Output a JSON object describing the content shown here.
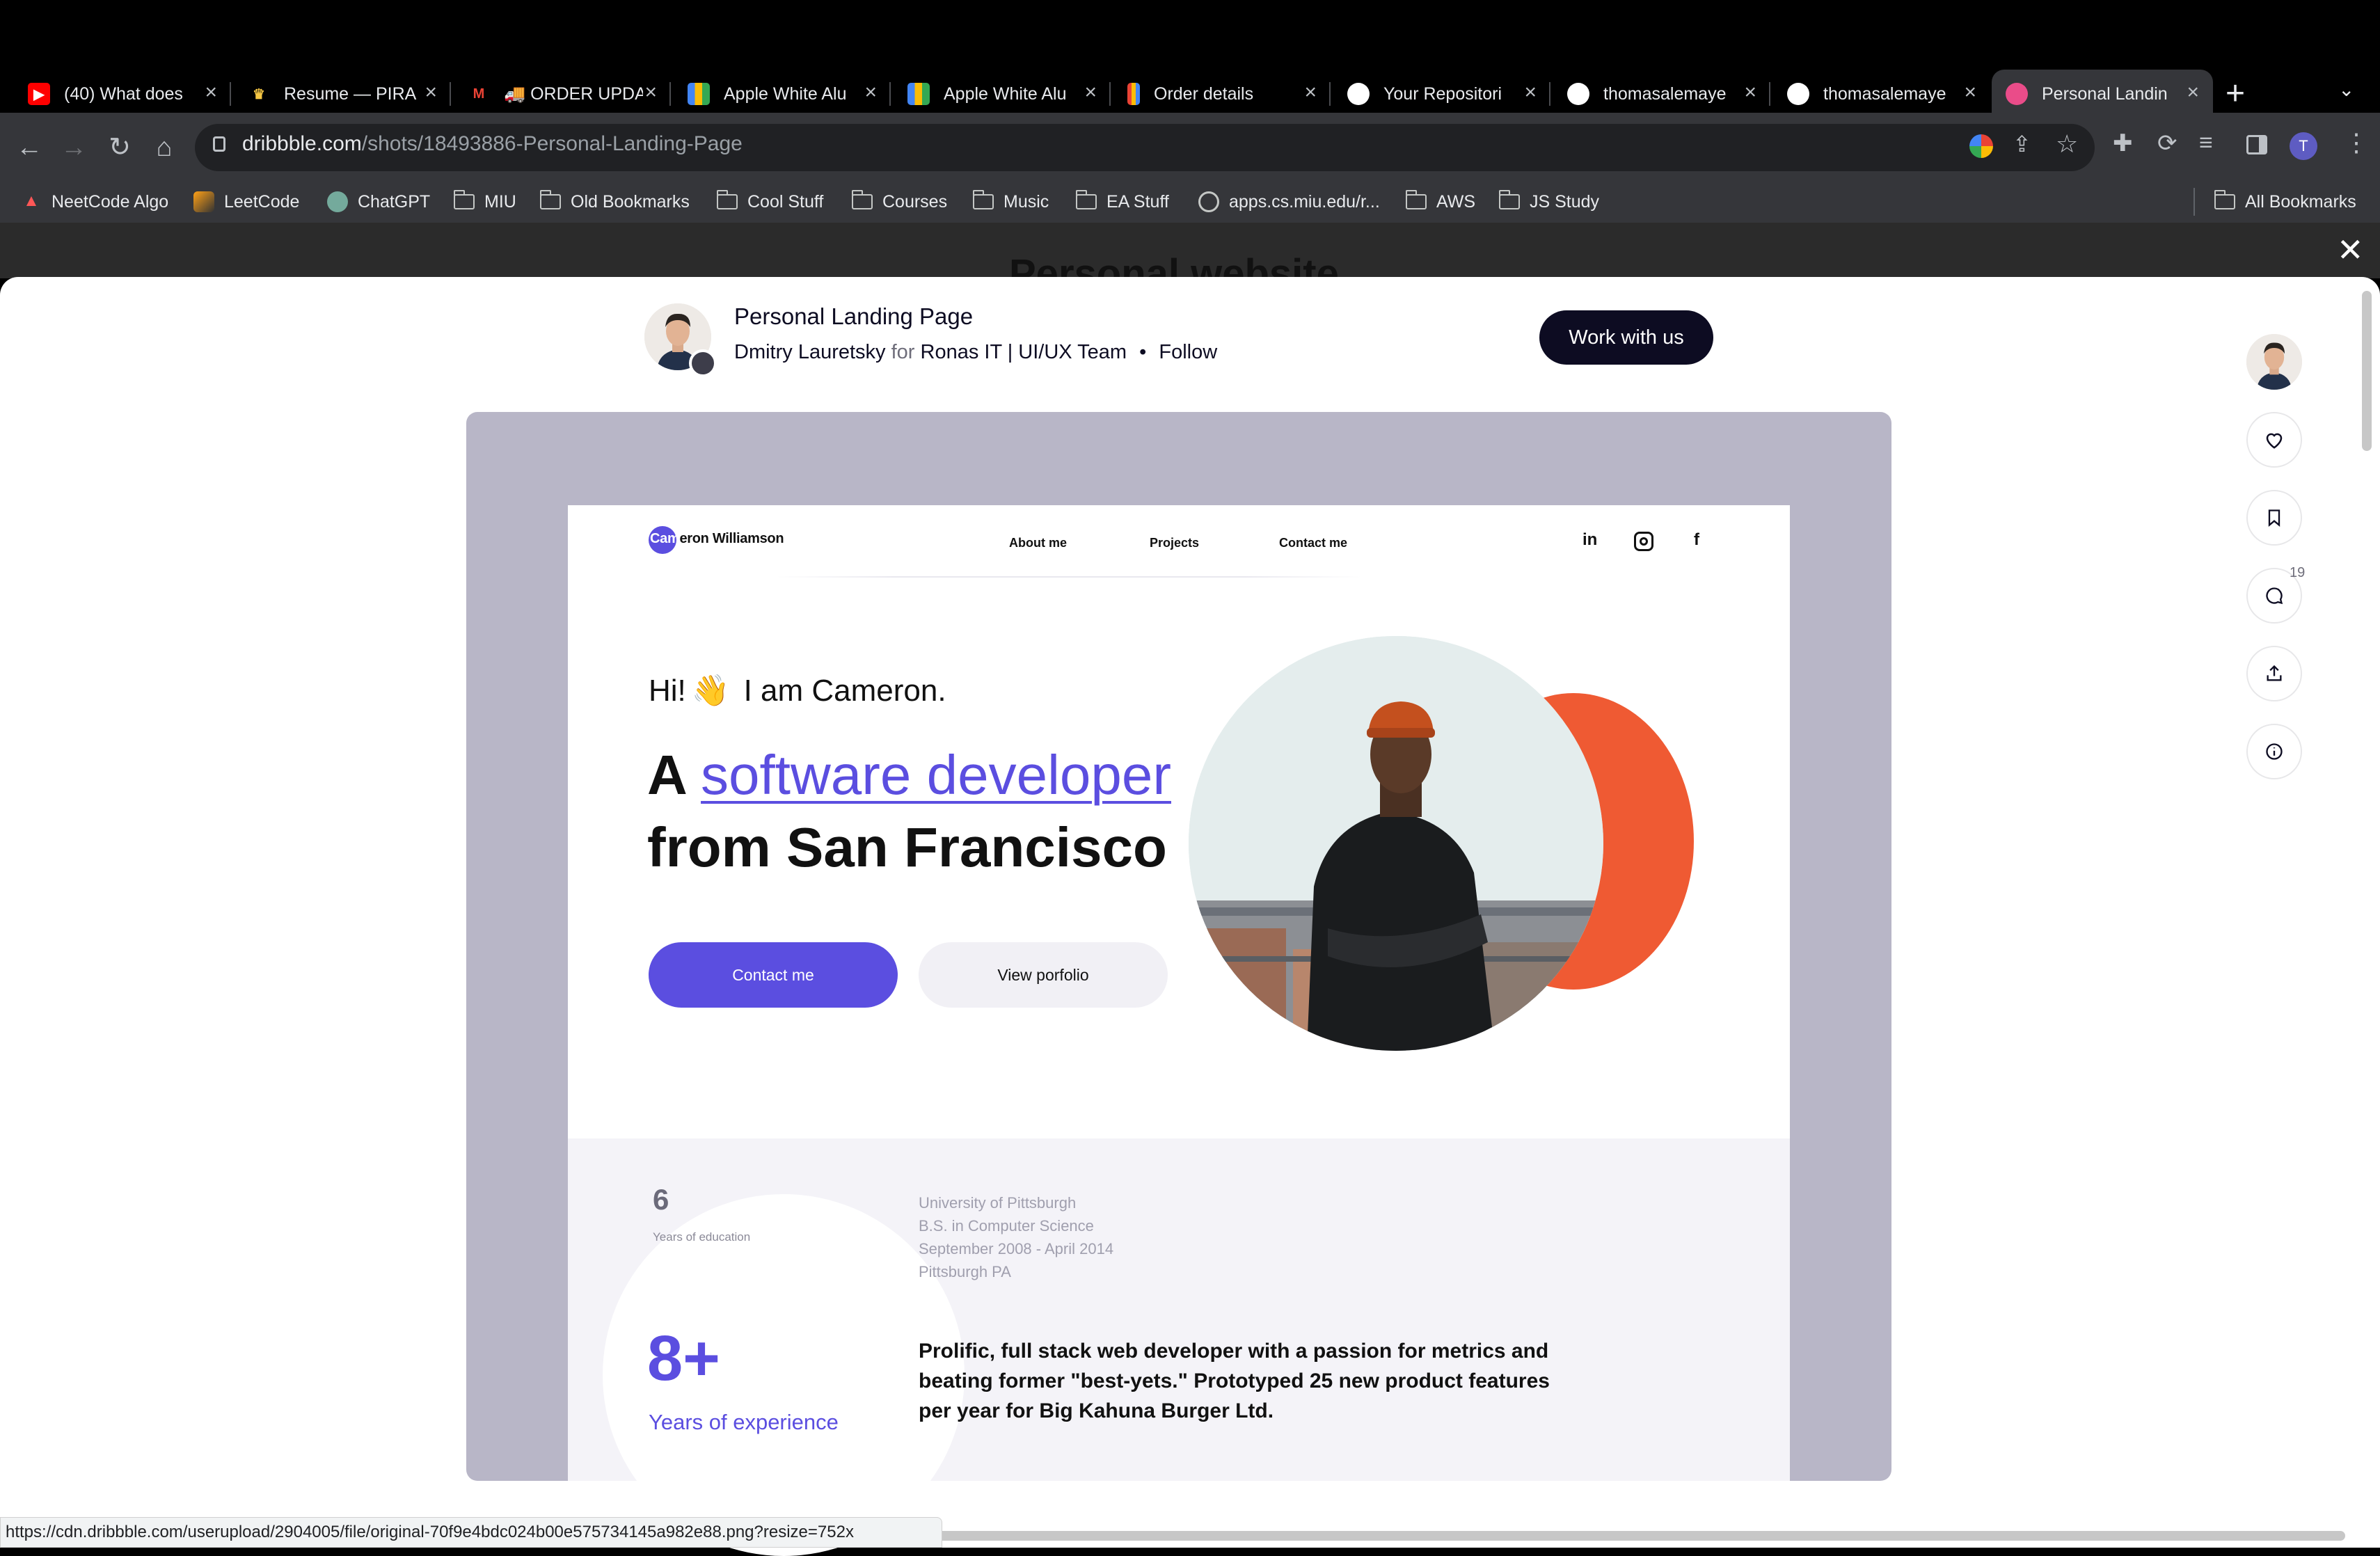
{
  "browser": {
    "tabs": [
      {
        "title": "(40) What does",
        "icon": "youtube-icon"
      },
      {
        "title": "Resume — PIRA",
        "icon": "crown-icon"
      },
      {
        "title": "🚚 ORDER UPDA",
        "icon": "gmail-icon"
      },
      {
        "title": "Apple White Alu",
        "icon": "store-icon"
      },
      {
        "title": "Apple White Alu",
        "icon": "store-icon"
      },
      {
        "title": "Order details",
        "icon": "order-icon"
      },
      {
        "title": "Your Repositori",
        "icon": "github-icon"
      },
      {
        "title": "thomasalemaye",
        "icon": "github-icon"
      },
      {
        "title": "thomasalemaye",
        "icon": "github-icon"
      },
      {
        "title": "Personal Landin",
        "icon": "dribbble-icon",
        "active": true
      }
    ],
    "url_host": "dribbble.com",
    "url_path": "/shots/18493886-Personal-Landing-Page",
    "profile_initial": "T",
    "bookmarks": [
      {
        "label": "NeetCode Algo",
        "icon": "rocket-icon"
      },
      {
        "label": "LeetCode",
        "icon": "leetcode-icon"
      },
      {
        "label": "ChatGPT",
        "icon": "chatgpt-icon"
      },
      {
        "label": "MIU",
        "icon": "folder-icon"
      },
      {
        "label": "Old Bookmarks",
        "icon": "folder-icon"
      },
      {
        "label": "Cool Stuff",
        "icon": "folder-icon"
      },
      {
        "label": "Courses",
        "icon": "folder-icon"
      },
      {
        "label": "Music",
        "icon": "folder-icon"
      },
      {
        "label": "EA Stuff",
        "icon": "folder-icon"
      },
      {
        "label": "apps.cs.miu.edu/r...",
        "icon": "globe-icon"
      },
      {
        "label": "AWS",
        "icon": "folder-icon"
      },
      {
        "label": "JS Study",
        "icon": "folder-icon"
      }
    ],
    "all_bookmarks": "All Bookmarks",
    "status_url": "https://cdn.dribbble.com/userupload/2904005/file/original-70f9e4bdc024b00e575734145a982e88.png?resize=752x"
  },
  "page": {
    "behind_title": "Personal website",
    "shot_title": "Personal Landing Page",
    "author": "Dmitry Lauretsky",
    "for_word": "for",
    "team": "Ronas IT | UI/UX Team",
    "bullet": "•",
    "follow": "Follow",
    "work_button": "Work with us",
    "comment_count": "19"
  },
  "shot": {
    "logo_text_highlight": "Cam",
    "logo_text_rest": "eron Williamson",
    "nav": [
      "About me",
      "Projects",
      "Contact me"
    ],
    "social": [
      "in",
      "ig",
      "f"
    ],
    "greeting_hi": "Hi!",
    "greeting_wave": "👋",
    "greeting_rest": "I am Cameron.",
    "headline_a": "A",
    "headline_highlight": "software developer",
    "headline_line2": "from San Francisco",
    "btn_contact": "Contact me",
    "btn_portfolio": "View porfolio",
    "stat_years_edu": "6",
    "stat_years_edu_label": "Years of education",
    "education": [
      "University of Pittsburgh",
      "B.S. in Computer Science",
      "September 2008 - April 2014",
      "Pittsburgh PA"
    ],
    "stat_experience": "8+",
    "stat_experience_label": "Years of experience",
    "description": "Prolific, full stack web developer with a passion for metrics and beating former \"best-yets.\" Prototyped 25 new product features per year for Big Kahuna Burger Ltd."
  },
  "colors": {
    "accent": "#5b4ee0",
    "orange": "#ef5a33",
    "dribbble_dark": "#0d0c22",
    "shot_bg": "#b8b6c7"
  }
}
